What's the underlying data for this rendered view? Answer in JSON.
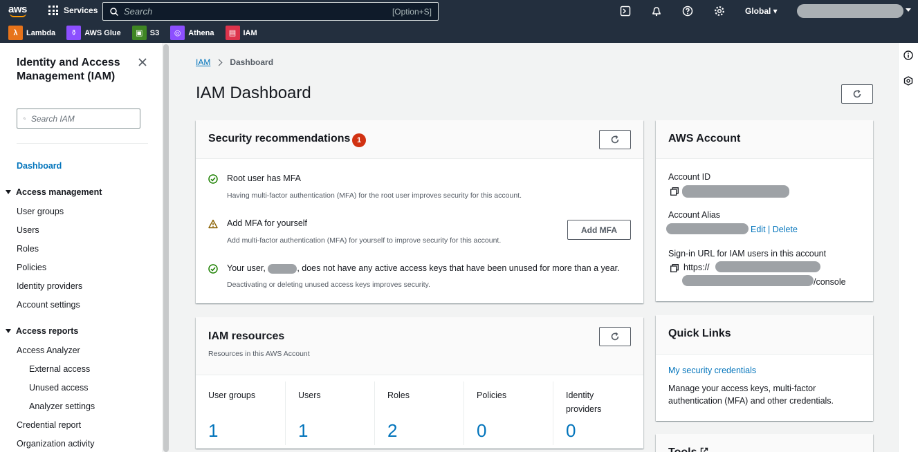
{
  "topnav": {
    "logo_text": "aws",
    "services_label": "Services",
    "search_placeholder": "Search",
    "search_shortcut": "[Option+S]",
    "region_label": "Global",
    "icons": [
      "cloudshell-icon",
      "notifications-icon",
      "help-icon",
      "settings-icon"
    ]
  },
  "favorites": [
    {
      "label": "Lambda",
      "color": "#e7731a",
      "glyph": "λ"
    },
    {
      "label": "AWS Glue",
      "color": "#8c4fff",
      "glyph": "⚱"
    },
    {
      "label": "S3",
      "color": "#3f8624",
      "glyph": "▣"
    },
    {
      "label": "Athena",
      "color": "#8c4fff",
      "glyph": "◎"
    },
    {
      "label": "IAM",
      "color": "#dd344c",
      "glyph": "▤"
    }
  ],
  "sidebar": {
    "title": "Identity and Access Management (IAM)",
    "search_placeholder": "Search IAM",
    "dashboard": "Dashboard",
    "access_management": {
      "heading": "Access management",
      "items": [
        "User groups",
        "Users",
        "Roles",
        "Policies",
        "Identity providers",
        "Account settings"
      ]
    },
    "access_reports": {
      "heading": "Access reports",
      "items": [
        "Access Analyzer",
        "External access",
        "Unused access",
        "Analyzer settings",
        "Credential report",
        "Organization activity"
      ]
    }
  },
  "breadcrumb": {
    "root": "IAM",
    "current": "Dashboard"
  },
  "page_title": "IAM Dashboard",
  "security": {
    "title": "Security recommendations",
    "badge": "1",
    "items": [
      {
        "status": "ok",
        "title": "Root user has MFA",
        "desc": "Having multi-factor authentication (MFA) for the root user improves security for this account."
      },
      {
        "status": "warning",
        "title": "Add MFA for yourself",
        "desc": "Add multi-factor authentication (MFA) for yourself to improve security for this account.",
        "action": "Add MFA"
      },
      {
        "status": "ok",
        "title_prefix": "Your user,",
        "title_suffix": ", does not have any active access keys that have been unused for more than a year.",
        "desc": "Deactivating or deleting unused access keys improves security."
      }
    ]
  },
  "resources": {
    "title": "IAM resources",
    "subtitle": "Resources in this AWS Account",
    "items": [
      {
        "label": "User groups",
        "value": "1"
      },
      {
        "label": "Users",
        "value": "1"
      },
      {
        "label": "Roles",
        "value": "2"
      },
      {
        "label": "Policies",
        "value": "0"
      },
      {
        "label": "Identity providers",
        "value": "0"
      }
    ]
  },
  "account": {
    "title": "AWS Account",
    "account_id_label": "Account ID",
    "alias_label": "Account Alias",
    "edit": "Edit",
    "separator": "|",
    "delete": "Delete",
    "signin_label": "Sign-in URL for IAM users in this account",
    "url_prefix": "https://",
    "url_suffix": "/console"
  },
  "quick_links": {
    "title": "Quick Links",
    "link": "My security credentials",
    "desc": "Manage your access keys, multi-factor authentication (MFA) and other credentials."
  },
  "tools": {
    "title": "Tools"
  },
  "colors": {
    "nav_bg": "#232f3e",
    "link": "#0073bb",
    "badge": "#d13212",
    "success": "#1d8102",
    "warning": "#8a6100",
    "page_bg": "#f2f3f3"
  }
}
